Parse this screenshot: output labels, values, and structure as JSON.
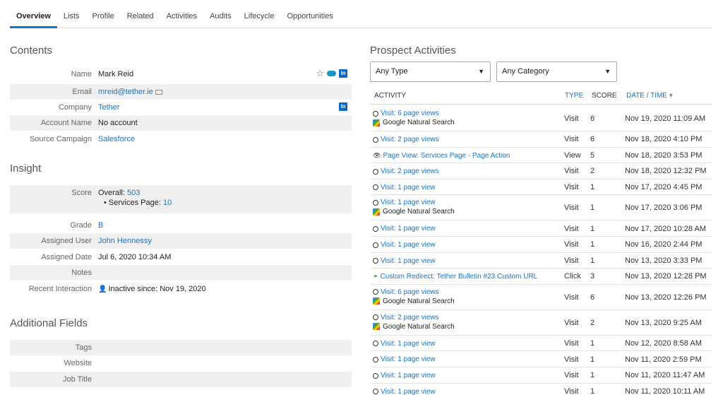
{
  "tabs": [
    "Overview",
    "Lists",
    "Profile",
    "Related",
    "Activities",
    "Audits",
    "Lifecycle",
    "Opportunities"
  ],
  "contents": {
    "title": "Contents",
    "name_label": "Name",
    "name": "Mark Reid",
    "email_label": "Email",
    "email": "mreid@tether.ie",
    "company_label": "Company",
    "company": "Tether",
    "account_label": "Account Name",
    "account": "No account",
    "campaign_label": "Source Campaign",
    "campaign": "Salesforce"
  },
  "insight": {
    "title": "Insight",
    "score_label": "Score",
    "overall_label": "Overall:",
    "overall": "503",
    "services_label": "Services Page:",
    "services": "10",
    "grade_label": "Grade",
    "grade": "B",
    "user_label": "Assigned User",
    "user": "John Hennessy",
    "date_label": "Assigned Date",
    "date": "Jul 6, 2020 10:34 AM",
    "notes_label": "Notes",
    "recent_label": "Recent Interaction",
    "recent": "Inactive since: Nov 19, 2020"
  },
  "additional": {
    "title": "Additional Fields",
    "tags_label": "Tags",
    "website_label": "Website",
    "job_label": "Job Title"
  },
  "activities": {
    "title": "Prospect Activities",
    "type_filter": "Any Type",
    "category_filter": "Any Category",
    "headers": {
      "activity": "ACTIVITY",
      "type": "TYPE",
      "score": "SCORE",
      "date": "DATE / TIME"
    },
    "rows": [
      {
        "icon": "clock",
        "text": "Visit: 6 page views",
        "source": "Google Natural Search",
        "type": "Visit",
        "score": "6",
        "date": "Nov 19, 2020 11:09 AM"
      },
      {
        "icon": "clock",
        "text": "Visit: 2 page views",
        "source": "",
        "type": "Visit",
        "score": "6",
        "date": "Nov 18, 2020 4:10 PM"
      },
      {
        "icon": "eye",
        "text": "Page View: Services Page - Page Action",
        "source": "",
        "type": "View",
        "score": "5",
        "date": "Nov 18, 2020 3:53 PM"
      },
      {
        "icon": "clock",
        "text": "Visit: 2 page views",
        "source": "",
        "type": "Visit",
        "score": "2",
        "date": "Nov 18, 2020 12:32 PM"
      },
      {
        "icon": "clock",
        "text": "Visit: 1 page view",
        "source": "",
        "type": "Visit",
        "score": "1",
        "date": "Nov 17, 2020 4:45 PM"
      },
      {
        "icon": "clock",
        "text": "Visit: 1 page view",
        "source": "Google Natural Search",
        "type": "Visit",
        "score": "1",
        "date": "Nov 17, 2020 3:06 PM"
      },
      {
        "icon": "clock",
        "text": "Visit: 1 page view",
        "source": "",
        "type": "Visit",
        "score": "1",
        "date": "Nov 17, 2020 10:28 AM"
      },
      {
        "icon": "clock",
        "text": "Visit: 1 page view",
        "source": "",
        "type": "Visit",
        "score": "1",
        "date": "Nov 16, 2020 2:44 PM"
      },
      {
        "icon": "clock",
        "text": "Visit: 1 page view",
        "source": "",
        "type": "Visit",
        "score": "1",
        "date": "Nov 13, 2020 3:33 PM"
      },
      {
        "icon": "redirect",
        "text": "Custom Redirect: Tether Bulletin #23 Custom URL",
        "source": "",
        "type": "Click",
        "score": "3",
        "date": "Nov 13, 2020 12:28 PM"
      },
      {
        "icon": "clock",
        "text": "Visit: 6 page views",
        "source": "Google Natural Search",
        "type": "Visit",
        "score": "6",
        "date": "Nov 13, 2020 12:26 PM"
      },
      {
        "icon": "clock",
        "text": "Visit: 2 page views",
        "source": "Google Natural Search",
        "type": "Visit",
        "score": "2",
        "date": "Nov 13, 2020 9:25 AM"
      },
      {
        "icon": "clock",
        "text": "Visit: 1 page view",
        "source": "",
        "type": "Visit",
        "score": "1",
        "date": "Nov 12, 2020 8:58 AM"
      },
      {
        "icon": "clock",
        "text": "Visit: 1 page view",
        "source": "",
        "type": "Visit",
        "score": "1",
        "date": "Nov 11, 2020 2:59 PM"
      },
      {
        "icon": "clock",
        "text": "Visit: 1 page view",
        "source": "",
        "type": "Visit",
        "score": "1",
        "date": "Nov 11, 2020 11:47 AM"
      },
      {
        "icon": "clock",
        "text": "Visit: 1 page view",
        "source": "",
        "type": "Visit",
        "score": "1",
        "date": "Nov 11, 2020 10:11 AM"
      }
    ]
  }
}
